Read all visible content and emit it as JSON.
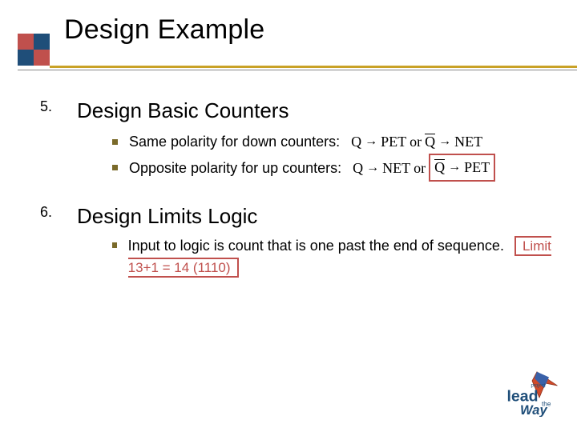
{
  "title": "Design Example",
  "items": [
    {
      "num": "5.",
      "heading": "Design Basic Counters",
      "subs": [
        {
          "text": "Same polarity for down counters:",
          "f": {
            "l1": "Q",
            "a1": "→",
            "m1": "PET",
            "or": "or",
            "l2": "Q",
            "a2": "→",
            "m2": "NET",
            "l2bar": true,
            "boxed": false
          }
        },
        {
          "text": "Opposite polarity for up counters:",
          "f": {
            "l1": "Q",
            "a1": "→",
            "m1": "NET",
            "or": "or",
            "l2": "Q",
            "a2": "→",
            "m2": "PET",
            "l2bar": true,
            "boxed": true
          }
        }
      ]
    },
    {
      "num": "6.",
      "heading": "Design Limits Logic",
      "subs": [
        {
          "text_long": "Input to logic is count that is one past the end of sequence.",
          "limitbox": "Limit 13+1 = 14 (1110)"
        }
      ]
    }
  ],
  "footer_logo": {
    "top": "project",
    "main": "lead",
    "bottom": "the\nWay"
  }
}
